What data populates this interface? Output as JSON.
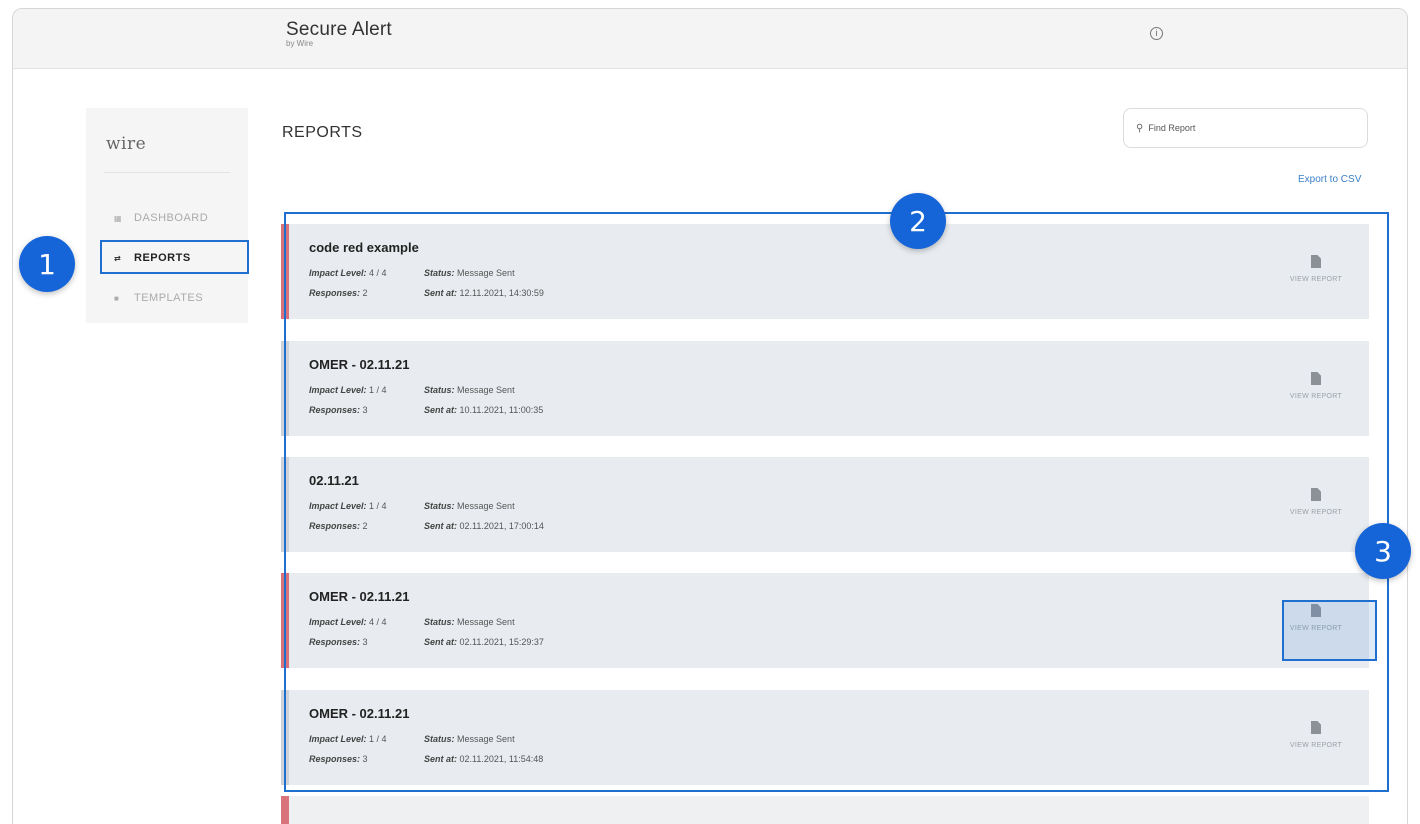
{
  "app": {
    "title": "Secure Alert",
    "subtitle": "by Wire",
    "logo_text": "wire"
  },
  "icons": {
    "info": "info-circle-icon",
    "search": "search-icon",
    "document": "document-icon"
  },
  "sidebar": {
    "items": [
      {
        "label": "DASHBOARD",
        "icon": "grid-icon",
        "glyph": "▦",
        "active": false
      },
      {
        "label": "REPORTS",
        "icon": "reports-icon",
        "glyph": "⇄",
        "active": true
      },
      {
        "label": "TEMPLATES",
        "icon": "templates-icon",
        "glyph": "■",
        "active": false
      }
    ]
  },
  "main": {
    "title": "REPORTS",
    "search_placeholder": "Find Report",
    "export_label": "Export to CSV",
    "field_labels": {
      "impact": "Impact Level:",
      "status": "Status:",
      "responses": "Responses:",
      "sent_at": "Sent at:"
    },
    "view_label": "VIEW REPORT",
    "reports": [
      {
        "name": "code red example",
        "impact": "4 / 4",
        "status": "Message Sent",
        "responses": "2",
        "sent_at": "12.11.2021, 14:30:59",
        "critical": true
      },
      {
        "name": "OMER - 02.11.21",
        "impact": "1 / 4",
        "status": "Message Sent",
        "responses": "3",
        "sent_at": "10.11.2021, 11:00:35",
        "critical": false
      },
      {
        "name": "02.11.21",
        "impact": "1 / 4",
        "status": "Message Sent",
        "responses": "2",
        "sent_at": "02.11.2021, 17:00:14",
        "critical": false
      },
      {
        "name": "OMER - 02.11.21",
        "impact": "4 / 4",
        "status": "Message Sent",
        "responses": "3",
        "sent_at": "02.11.2021, 15:29:37",
        "critical": true
      },
      {
        "name": "OMER - 02.11.21",
        "impact": "1 / 4",
        "status": "Message Sent",
        "responses": "3",
        "sent_at": "02.11.2021, 11:54:48",
        "critical": false
      }
    ]
  },
  "callouts": [
    "1",
    "2",
    "3"
  ],
  "colors": {
    "accent": "#1565d8",
    "critical": "#d9737b",
    "normal": "#cfd3d8",
    "link": "#3a7fc8"
  }
}
